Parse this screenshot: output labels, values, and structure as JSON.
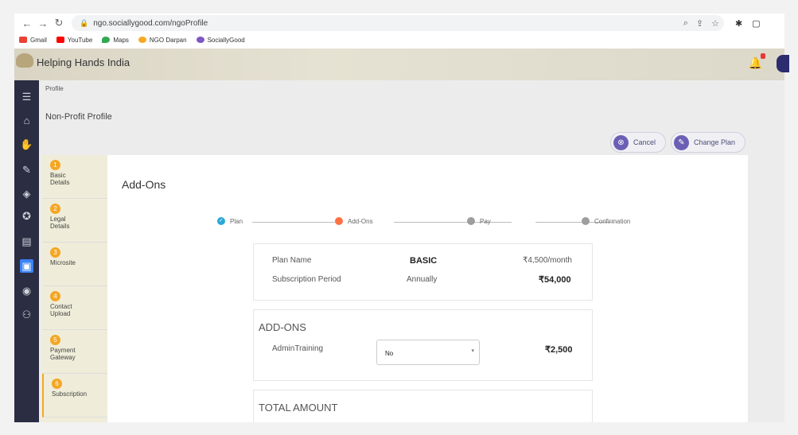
{
  "browser": {
    "url": "ngo.sociallygood.com/ngoProfile",
    "bookmarks": [
      "Gmail",
      "YouTube",
      "Maps",
      "NGO Darpan",
      "SociallyGood"
    ]
  },
  "app": {
    "org_name": "Helping Hands India",
    "notification_count": "0"
  },
  "breadcrumb": "Profile",
  "page_title": "Non-Profit Profile",
  "actions": {
    "cancel": "Cancel",
    "change_plan": "Change Plan"
  },
  "steps": [
    {
      "num": "1",
      "line1": "Basic",
      "line2": "Details"
    },
    {
      "num": "2",
      "line1": "Legal",
      "line2": "Details"
    },
    {
      "num": "3",
      "line1": "Microsite",
      "line2": ""
    },
    {
      "num": "4",
      "line1": "Contact",
      "line2": "Upload"
    },
    {
      "num": "5",
      "line1": "Payment",
      "line2": "Gateway"
    },
    {
      "num": "6",
      "line1": "Subscription",
      "line2": ""
    }
  ],
  "modal": {
    "title": "Add-Ons",
    "stepper": [
      "Plan",
      "Add-Ons",
      "Pay",
      "Confirmation"
    ],
    "plan": {
      "name_label": "Plan Name",
      "name_value": "BASIC",
      "price_month": "₹4,500/month",
      "period_label": "Subscription Period",
      "period_value": "Annually",
      "price_total": "₹54,000"
    },
    "addons": {
      "title": "ADD-ONS",
      "item_label": "AdminTraining",
      "item_selected": "No",
      "item_price": "₹2,500"
    },
    "total": {
      "title": "TOTAL AMOUNT"
    }
  },
  "colors": {
    "sidebar": "#2b2d42",
    "accent": "#f5a623",
    "plan_done": "#29a8d8",
    "current": "#ff7043",
    "pending": "#9e9e9e"
  }
}
